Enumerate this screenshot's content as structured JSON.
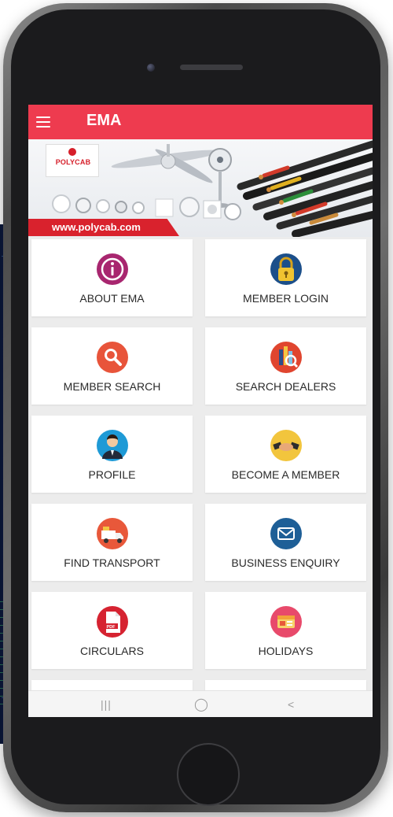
{
  "app": {
    "title": "EMA"
  },
  "banner": {
    "brand": "POLYCAB",
    "url": "www.polycab.com"
  },
  "menu": [
    {
      "label": "ABOUT EMA",
      "icon": "info-icon",
      "color": "#a8266f"
    },
    {
      "label": "MEMBER LOGIN",
      "icon": "lock-icon",
      "color": "#1c4f8a"
    },
    {
      "label": "MEMBER SEARCH",
      "icon": "search-icon",
      "color": "#e8543a"
    },
    {
      "label": "SEARCH DEALERS",
      "icon": "dealers-icon",
      "color": "#e0452f"
    },
    {
      "label": "PROFILE",
      "icon": "profile-icon",
      "color": "#1e9ad6"
    },
    {
      "label": "BECOME A MEMBER",
      "icon": "handshake-icon",
      "color": "#f2c53d"
    },
    {
      "label": "FIND TRANSPORT",
      "icon": "truck-icon",
      "color": "#e8583a"
    },
    {
      "label": "BUSINESS ENQUIRY",
      "icon": "mail-icon",
      "color": "#1e5f97"
    },
    {
      "label": "CIRCULARS",
      "icon": "pdf-icon",
      "color": "#d62331"
    },
    {
      "label": "HOLIDAYS",
      "icon": "calendar-icon",
      "color": "#e84a6b"
    }
  ],
  "nav": {
    "recents": "|||",
    "home": "◯",
    "back": "<"
  },
  "colors": {
    "appbar": "#ee3b4f",
    "screen_bg": "#ececec"
  }
}
